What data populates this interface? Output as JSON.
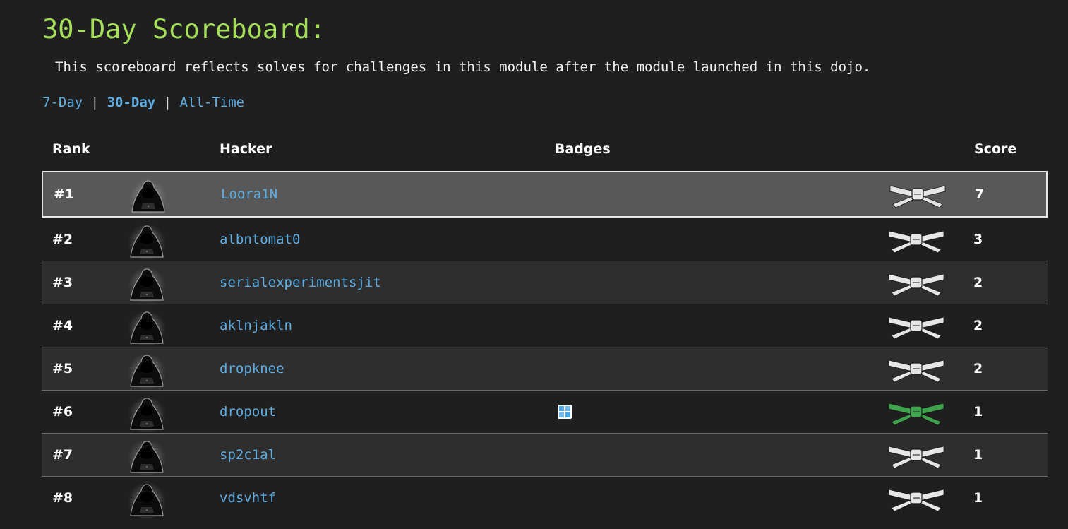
{
  "page": {
    "title": "30-Day Scoreboard:",
    "description": "This scoreboard reflects solves for challenges in this module after the module launched in this dojo."
  },
  "tabs": [
    {
      "label": "7-Day",
      "active": false
    },
    {
      "label": "30-Day",
      "active": true
    },
    {
      "label": "All-Time",
      "active": false
    }
  ],
  "tab_separator": "|",
  "table": {
    "headers": {
      "rank": "Rank",
      "hacker": "Hacker",
      "badges": "Badges",
      "score": "Score"
    },
    "rows": [
      {
        "rank": "#1",
        "hacker": "Loora1N",
        "badge": false,
        "belt": "white-belt",
        "score": "7",
        "selected": true
      },
      {
        "rank": "#2",
        "hacker": "albntomat0",
        "badge": false,
        "belt": "white-belt",
        "score": "3",
        "selected": false
      },
      {
        "rank": "#3",
        "hacker": "serialexperimentsjit",
        "badge": false,
        "belt": "white-belt",
        "score": "2",
        "selected": false
      },
      {
        "rank": "#4",
        "hacker": "aklnjakln",
        "badge": false,
        "belt": "white-belt",
        "score": "2",
        "selected": false
      },
      {
        "rank": "#5",
        "hacker": "dropknee",
        "badge": false,
        "belt": "white-belt",
        "score": "2",
        "selected": false
      },
      {
        "rank": "#6",
        "hacker": "dropout",
        "badge": true,
        "belt": "green-belt",
        "score": "1",
        "selected": false
      },
      {
        "rank": "#7",
        "hacker": "sp2c1al",
        "badge": false,
        "belt": "white-belt",
        "score": "1",
        "selected": false
      },
      {
        "rank": "#8",
        "hacker": "vdsvhtf",
        "badge": false,
        "belt": "white-belt",
        "score": "1",
        "selected": false
      }
    ]
  },
  "colors": {
    "title": "#a6e05a",
    "link": "#5dade2",
    "white_belt": "#e6e6e6",
    "green_belt": "#3fa34d",
    "badge": "#4aa8e8"
  },
  "icons": {
    "avatar": "hooded-hacker-icon",
    "badge": "square-badge-icon",
    "belt": "belt-icon"
  }
}
